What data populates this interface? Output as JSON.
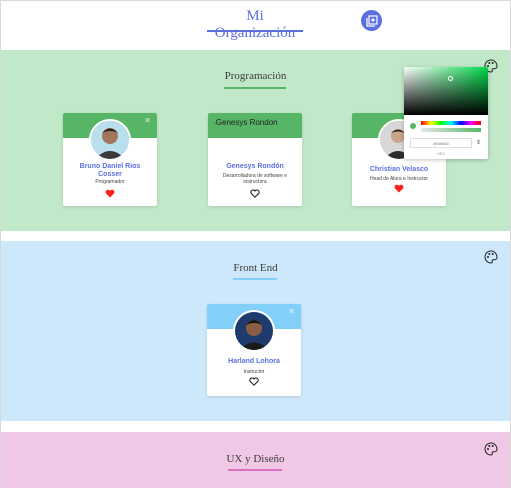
{
  "header": {
    "title": "Mi Organización"
  },
  "sections": {
    "programacion": {
      "title": "Programación",
      "accent": "#56b665",
      "cards": [
        {
          "name": "Bruno Daniel Rios Cosser",
          "role": "Programador",
          "liked": true
        },
        {
          "name": "Genesys Rondón",
          "role": "Desarrolladora de software e instructora",
          "liked": false,
          "broken_image_alt": "Genesys Rondon"
        },
        {
          "name": "Christian Velasco",
          "role": "Head de Alura e Instructor",
          "liked": true
        }
      ]
    },
    "front_end": {
      "title": "Front End",
      "accent": "#82cffa",
      "cards": [
        {
          "name": "Harland Lohora",
          "role": "Instructor",
          "liked": false
        }
      ]
    },
    "ux": {
      "title": "UX y Diseño",
      "accent": "#db6ebf"
    }
  },
  "color_picker": {
    "hex_value": "#56b665",
    "mode_label": "HEX"
  },
  "colors": {
    "primary": "#5b6fe0",
    "heart": "#ff2020",
    "prog_bg": "#c1e8c8",
    "front_bg": "#cde8fb",
    "ux_bg": "#f0c8e6"
  }
}
